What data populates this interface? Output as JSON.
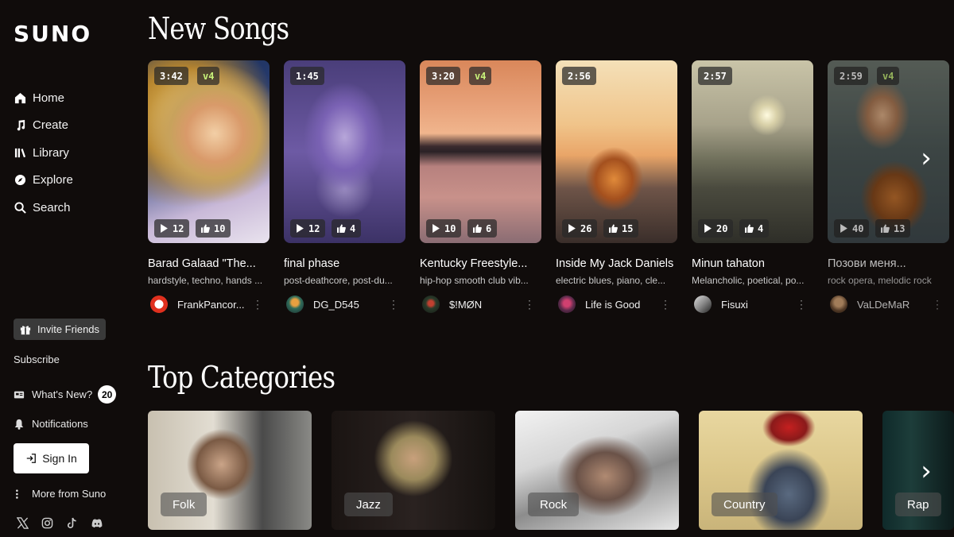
{
  "brand": {
    "logo": "SUNO"
  },
  "nav": [
    {
      "label": "Home",
      "icon": "home-icon"
    },
    {
      "label": "Create",
      "icon": "music-note-icon"
    },
    {
      "label": "Library",
      "icon": "library-icon"
    },
    {
      "label": "Explore",
      "icon": "compass-icon"
    },
    {
      "label": "Search",
      "icon": "search-icon"
    }
  ],
  "sidebar": {
    "invite_label": "Invite Friends",
    "subscribe_label": "Subscribe",
    "whats_new_label": "What's New?",
    "whats_new_count": "20",
    "notifications_label": "Notifications",
    "signin_label": "Sign In",
    "more_label": "More from Suno",
    "socials": [
      "x-icon",
      "instagram-icon",
      "tiktok-icon",
      "discord-icon"
    ]
  },
  "new_songs": {
    "title": "New Songs",
    "songs": [
      {
        "duration": "3:42",
        "version": "v4",
        "plays": "12",
        "likes": "10",
        "title": "Barad Galaad \"The...",
        "tags": "hardstyle, techno, hands ...",
        "artist": "FrankPancor..."
      },
      {
        "duration": "1:45",
        "version": "",
        "plays": "12",
        "likes": "4",
        "title": "final phase",
        "tags": "post-deathcore, post-du...",
        "artist": "DG_D545"
      },
      {
        "duration": "3:20",
        "version": "v4",
        "plays": "10",
        "likes": "6",
        "title": "Kentucky Freestyle...",
        "tags": "hip-hop smooth club vib...",
        "artist": "$!MØN"
      },
      {
        "duration": "2:56",
        "version": "",
        "plays": "26",
        "likes": "15",
        "title": "Inside My Jack Daniels",
        "tags": "electric blues, piano, cle...",
        "artist": "Life is Good"
      },
      {
        "duration": "2:57",
        "version": "",
        "plays": "20",
        "likes": "4",
        "title": "Minun tahaton",
        "tags": "Melancholic, poetical, po...",
        "artist": "Fisuxi"
      },
      {
        "duration": "2:59",
        "version": "v4",
        "plays": "40",
        "likes": "13",
        "title": "Позови меня...",
        "tags": "rock opera, melodic rock",
        "artist": "VaLDeMaR"
      }
    ]
  },
  "top_categories": {
    "title": "Top Categories",
    "items": [
      "Folk",
      "Jazz",
      "Rock",
      "Country",
      "Rap"
    ]
  },
  "colors": {
    "background": "#100c0b",
    "v4_accent": "#c8f27a"
  }
}
